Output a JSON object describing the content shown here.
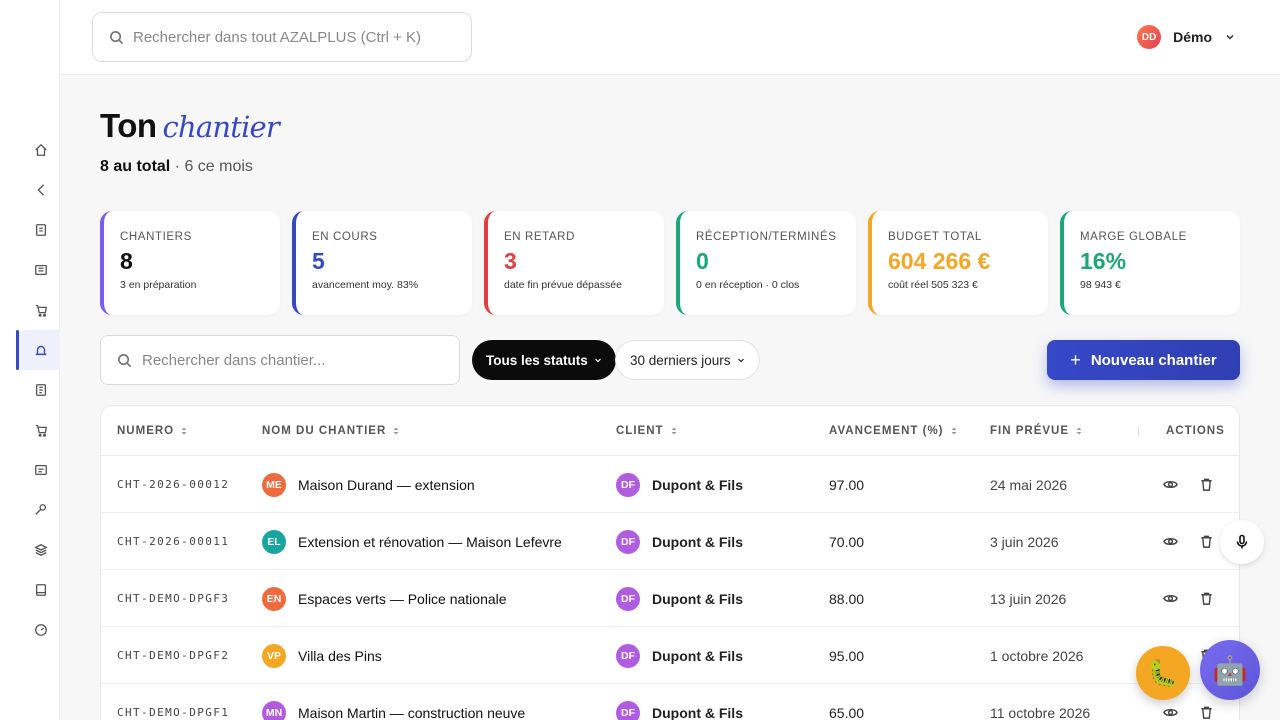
{
  "header": {
    "search_placeholder": "Rechercher dans tout AZALPLUS (Ctrl + K)",
    "user_initials": "DD",
    "user_name": "Démo"
  },
  "sidebar": {
    "items": [
      {
        "icon": "home-icon"
      },
      {
        "icon": "back-icon"
      },
      {
        "icon": "document-icon"
      },
      {
        "icon": "list-icon"
      },
      {
        "icon": "cart-icon"
      },
      {
        "icon": "worksite-icon",
        "active": true
      },
      {
        "icon": "receipt-icon"
      },
      {
        "icon": "cart-icon"
      },
      {
        "icon": "invoice-icon"
      },
      {
        "icon": "tools-icon"
      },
      {
        "icon": "layers-icon"
      },
      {
        "icon": "book-icon"
      },
      {
        "icon": "dashboard-icon"
      }
    ]
  },
  "page": {
    "title_strong": "Ton",
    "title_em": "chantier",
    "total": "8 au total",
    "month": " · 6 ce mois"
  },
  "stats": [
    {
      "label": "CHANTIERS",
      "value": "8",
      "note": "3 en préparation",
      "color": "#7b5cf5"
    },
    {
      "label": "EN COURS",
      "value": "5",
      "note": "avancement moy. 83%",
      "color": "#3548c8"
    },
    {
      "label": "EN RETARD",
      "value": "3",
      "note": "date fin prévue dépassée",
      "color": "#e53e3e"
    },
    {
      "label": "RÉCEPTION/TERMINÉS",
      "value": "0",
      "note": "0 en réception · 0 clos",
      "color": "#19a974"
    },
    {
      "label": "BUDGET TOTAL",
      "value": "604 266 €",
      "note": "coût réel 505 323 €",
      "color": "#f5a623"
    },
    {
      "label": "MARGE GLOBALE",
      "value": "16%",
      "note": "98 943 €",
      "color": "#19a974"
    }
  ],
  "toolbar": {
    "search_placeholder": "Rechercher dans chantier...",
    "status_filter": "Tous les statuts",
    "period_filter": "30 derniers jours",
    "new_button": "Nouveau chantier"
  },
  "table": {
    "headers": {
      "numero": "NUMERO",
      "nom": "NOM DU CHANTIER",
      "client": "CLIENT",
      "avancement": "AVANCEMENT (%)",
      "fin": "FIN PRÉVUE",
      "actions": "ACTIONS"
    },
    "rows": [
      {
        "numero": "CHT-2026-00012",
        "initials": "ME",
        "avatar_color": "#ef6a3c",
        "nom": "Maison Durand — extension",
        "client_initials": "DF",
        "client": "Dupont & Fils",
        "avancement": "97.00",
        "fin": "24 mai 2026"
      },
      {
        "numero": "CHT-2026-00011",
        "initials": "EL",
        "avatar_color": "#17a5a0",
        "nom": "Extension et rénovation — Maison Lefevre",
        "client_initials": "DF",
        "client": "Dupont & Fils",
        "avancement": "70.00",
        "fin": "3 juin 2026"
      },
      {
        "numero": "CHT-DEMO-DPGF3",
        "initials": "EN",
        "avatar_color": "#ef6a3c",
        "nom": "Espaces verts — Police nationale",
        "client_initials": "DF",
        "client": "Dupont & Fils",
        "avancement": "88.00",
        "fin": "13 juin 2026"
      },
      {
        "numero": "CHT-DEMO-DPGF2",
        "initials": "VP",
        "avatar_color": "#f5a623",
        "nom": "Villa des Pins",
        "client_initials": "DF",
        "client": "Dupont & Fils",
        "avancement": "95.00",
        "fin": "1 octobre 2026"
      },
      {
        "numero": "CHT-DEMO-DPGF1",
        "initials": "MN",
        "avatar_color": "#b15ce0",
        "nom": "Maison Martin — construction neuve",
        "client_initials": "DF",
        "client": "Dupont & Fils",
        "avancement": "65.00",
        "fin": "11 octobre 2026"
      }
    ]
  }
}
